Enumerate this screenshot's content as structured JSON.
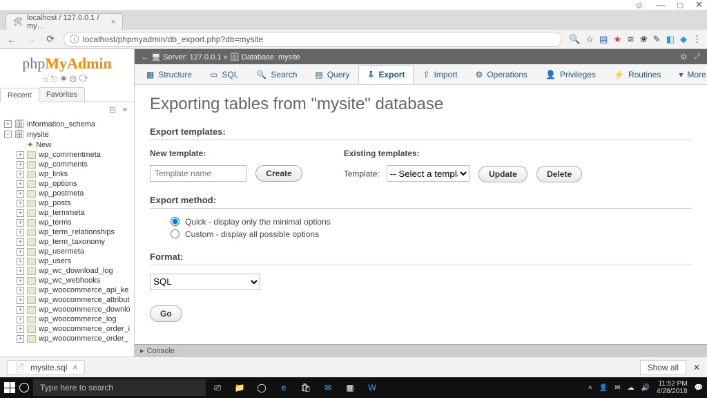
{
  "window_controls": {
    "min": "—",
    "max": "□",
    "close": "✕",
    "user": "☺"
  },
  "browser": {
    "tab_title": "localhost / 127.0.0.1 / my…",
    "url": "localhost/phpmyadmin/db_export.php?db=mysite",
    "nav": {
      "back": "←",
      "fwd": "→",
      "reload": "⟳"
    }
  },
  "pma": {
    "logo": {
      "a": "php",
      "b": "MyAdmin"
    },
    "side_tabs": {
      "recent": "Recent",
      "favorites": "Favorites"
    },
    "tree": {
      "db1": "information_schema",
      "db2": "mysite",
      "new": "New",
      "tables": [
        "wp_commentmeta",
        "wp_comments",
        "wp_links",
        "wp_options",
        "wp_postmeta",
        "wp_posts",
        "wp_termmeta",
        "wp_terms",
        "wp_term_relationships",
        "wp_term_taxonomy",
        "wp_usermeta",
        "wp_users",
        "wp_wc_download_log",
        "wp_wc_webhooks",
        "wp_woocommerce_api_ke",
        "wp_woocommerce_attribut",
        "wp_woocommerce_downlo",
        "wp_woocommerce_log",
        "wp_woocommerce_order_i",
        "wp_woocommerce_order_"
      ]
    },
    "breadcrumb": {
      "server": "Server: 127.0.0.1",
      "db": "Database: mysite"
    },
    "tabs": [
      "Structure",
      "SQL",
      "Search",
      "Query",
      "Export",
      "Import",
      "Operations",
      "Privileges",
      "Routines",
      "More"
    ],
    "tab_icons": [
      "▦",
      "▭",
      "🔍",
      "▤",
      "⇩",
      "⇧",
      "⚙",
      "👤",
      "⚡",
      "▾"
    ],
    "active_tab": 4,
    "heading": "Exporting tables from \"mysite\" database",
    "sections": {
      "templates": "Export templates:",
      "method": "Export method:",
      "format": "Format:"
    },
    "templates": {
      "new_label": "New template:",
      "placeholder": "Template name",
      "create": "Create",
      "existing_label": "Existing templates:",
      "select_label": "Template:",
      "select_value": "-- Select a template --",
      "update": "Update",
      "delete": "Delete"
    },
    "method": {
      "quick": "Quick - display only the minimal options",
      "custom": "Custom - display all possible options"
    },
    "format_value": "SQL",
    "go": "Go",
    "console": "Console"
  },
  "download": {
    "file": "mysite.sql",
    "showall": "Show all",
    "close": "✕"
  },
  "taskbar": {
    "search_placeholder": "Type here to search",
    "time": "11:52 PM",
    "date": "4/28/2018"
  }
}
